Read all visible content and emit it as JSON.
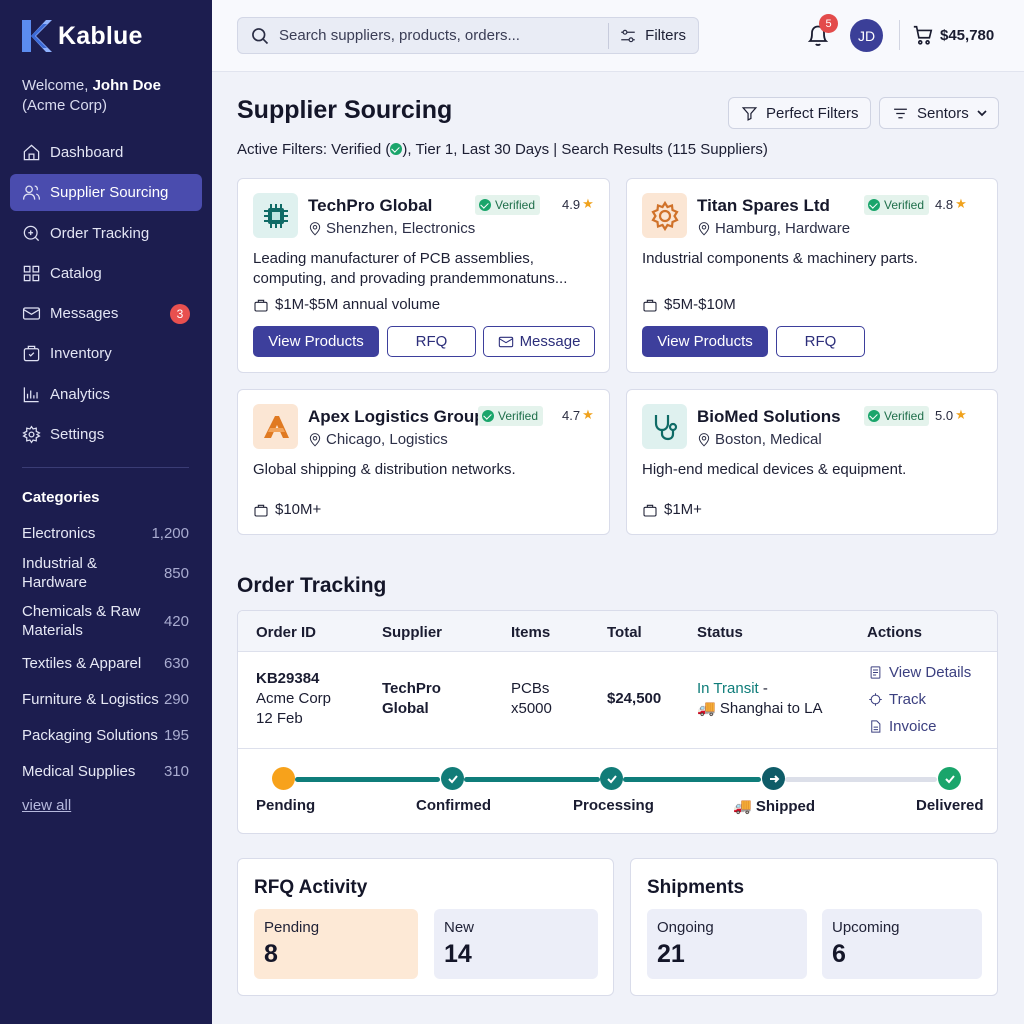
{
  "app": {
    "name": "Kablue"
  },
  "user": {
    "welcome": "Welcome,",
    "name": "John Doe",
    "company": "(Acme Corp)",
    "initials": "JD"
  },
  "nav": [
    {
      "label": "Dashboard",
      "icon": "home-icon",
      "active": false
    },
    {
      "label": "Supplier Sourcing",
      "icon": "users-icon",
      "active": true
    },
    {
      "label": "Order Tracking",
      "icon": "search-plus-icon",
      "active": false
    },
    {
      "label": "Catalog",
      "icon": "grid-icon",
      "active": false
    },
    {
      "label": "Messages",
      "icon": "mail-icon",
      "active": false,
      "badge": "3"
    },
    {
      "label": "Inventory",
      "icon": "box-icon",
      "active": false
    },
    {
      "label": "Analytics",
      "icon": "bar-chart-icon",
      "active": false
    },
    {
      "label": "Settings",
      "icon": "gear-icon",
      "active": false
    }
  ],
  "categories": {
    "title": "Categories",
    "items": [
      {
        "label": "Electronics",
        "count": "1,200"
      },
      {
        "label": "Industrial & Hardware",
        "count": "850"
      },
      {
        "label": "Chemicals & Raw Materials",
        "count": "420"
      },
      {
        "label": "Textiles & Apparel",
        "count": "630"
      },
      {
        "label": "Furniture & Logistics",
        "count": "290"
      },
      {
        "label": "Packaging Solutions",
        "count": "195"
      },
      {
        "label": "Medical Supplies",
        "count": "310"
      }
    ],
    "view_all": "view all"
  },
  "header": {
    "search_placeholder": "Search suppliers, products, orders...",
    "filters_label": "Filters",
    "notifications": "5",
    "cart_total": "$45,780"
  },
  "main": {
    "title": "Supplier Sourcing",
    "perfect_filters": "Perfect Filters",
    "sentors": "Sentors",
    "active_filters_prefix": "Active Filters: Verified (",
    "active_filters_suffix": "), Tier 1, Last 30 Days | Search Results (115 Suppliers)"
  },
  "suppliers": [
    {
      "name": "TechPro Global",
      "location": "Shenzhen, Electronics",
      "verified": "Verified",
      "rating": "4.9",
      "desc": "Leading manufacturer of PCB assemblies, computing, and provading prandemmonatuns...",
      "volume": "$1M-$5M annual volume",
      "view": "View Products",
      "rfq": "RFQ",
      "message": "Message"
    },
    {
      "name": "Titan Spares Ltd",
      "location": "Hamburg, Hardware",
      "verified": "Verified",
      "rating": "4.8",
      "desc": "Industrial components & machinery parts.",
      "volume": "$5M-$10M",
      "view": "View Products",
      "rfq": "RFQ"
    },
    {
      "name": "Apex Logistics Group",
      "location": "Chicago, Logistics",
      "verified": "Verified",
      "rating": "4.7",
      "desc": "Global shipping & distribution networks.",
      "volume": "$10M+"
    },
    {
      "name": "BioMed Solutions",
      "location": "Boston, Medical",
      "verified": "Verified",
      "rating": "5.0",
      "desc": "High-end medical devices & equipment.",
      "volume": "$1M+"
    }
  ],
  "order_tracking": {
    "title": "Order Tracking",
    "columns": [
      "Order ID",
      "Supplier",
      "Items",
      "Total",
      "Status",
      "Actions"
    ],
    "row": {
      "order_id": "KB29384",
      "buyer": "Acme Corp",
      "date": "12 Feb",
      "supplier_line1": "TechPro",
      "supplier_line2": "Global",
      "items_line1": "PCBs",
      "items_line2": "x5000",
      "total": "$24,500",
      "status": "In Transit",
      "status_dash": " -",
      "route": "Shanghai to LA"
    },
    "actions": [
      "View Details",
      "Track",
      "Invoice"
    ],
    "steps": [
      "Pending",
      "Confirmed",
      "Processing",
      "Shipped",
      "Delivered"
    ]
  },
  "rfq": {
    "title": "RFQ Activity",
    "pending_label": "Pending",
    "pending": "8",
    "new_label": "New",
    "new": "14"
  },
  "shipments": {
    "title": "Shipments",
    "ongoing_label": "Ongoing",
    "ongoing": "21",
    "upcoming_label": "Upcoming",
    "upcoming": "6"
  },
  "colors": {
    "sidebar": "#1c1d4f",
    "accent": "#3d3f9c",
    "verified": "#1aa56b",
    "transit": "#0f7d7a",
    "pending": "#f7a21b"
  }
}
